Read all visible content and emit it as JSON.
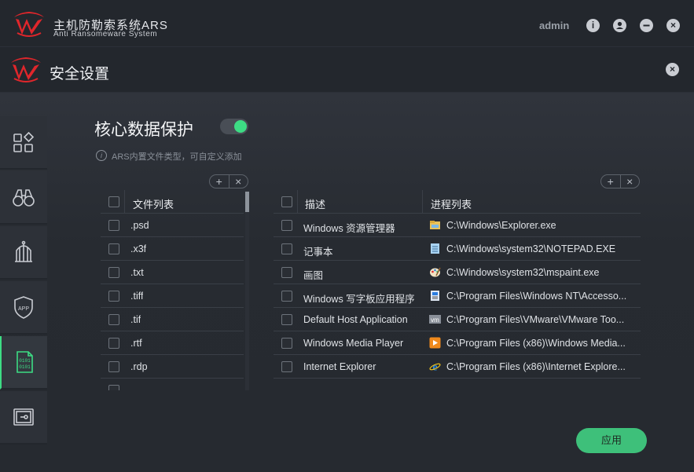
{
  "app": {
    "name": "主机防勒索系统ARS",
    "subtitle": "Anti Ransomeware System",
    "user": "admin",
    "info_icon": "info-icon",
    "user_icon": "user-icon",
    "minimize_icon": "minimize-icon",
    "close_icon": "close-icon"
  },
  "page": {
    "title": "安全设置",
    "close_icon": "close-icon"
  },
  "sidebar": {
    "items": [
      {
        "icon": "apps-grid-icon",
        "active": false
      },
      {
        "icon": "binoculars-icon",
        "active": false
      },
      {
        "icon": "birdcage-icon",
        "active": false
      },
      {
        "icon": "app-shield-icon",
        "active": false
      },
      {
        "icon": "binary-file-icon",
        "active": true
      },
      {
        "icon": "safe-box-icon",
        "active": false
      }
    ]
  },
  "section": {
    "title": "核心数据保护",
    "toggle_on": true,
    "hint": "ARS内置文件类型，可自定义添加"
  },
  "file_table": {
    "add": "+",
    "remove": "×",
    "header": "文件列表",
    "rows": [
      ".psd",
      ".x3f",
      ".txt",
      ".tiff",
      ".tif",
      ".rtf",
      ".rdp"
    ]
  },
  "process_table": {
    "add": "+",
    "remove": "×",
    "headers": {
      "desc": "描述",
      "process": "进程列表"
    },
    "rows": [
      {
        "desc": "Windows 资源管理器",
        "process": "C:\\Windows\\Explorer.exe",
        "icon": "explorer-icon"
      },
      {
        "desc": "记事本",
        "process": "C:\\Windows\\system32\\NOTEPAD.EXE",
        "icon": "notepad-icon"
      },
      {
        "desc": "画图",
        "process": "C:\\Windows\\system32\\mspaint.exe",
        "icon": "paint-icon"
      },
      {
        "desc": "Windows 写字板应用程序",
        "process": "C:\\Program Files\\Windows NT\\Accesso...",
        "icon": "wordpad-icon"
      },
      {
        "desc": "Default Host Application",
        "process": "C:\\Program Files\\VMware\\VMware Too...",
        "icon": "vmware-icon"
      },
      {
        "desc": "Windows Media Player",
        "process": "C:\\Program Files (x86)\\Windows Media...",
        "icon": "media-player-icon"
      },
      {
        "desc": "Internet Explorer",
        "process": "C:\\Program Files (x86)\\Internet Explore...",
        "icon": "internet-explorer-icon"
      }
    ]
  },
  "apply_label": "应用",
  "colors": {
    "accent": "#3ddc84",
    "brand_red": "#e0262b",
    "apply": "#3ec07a"
  }
}
